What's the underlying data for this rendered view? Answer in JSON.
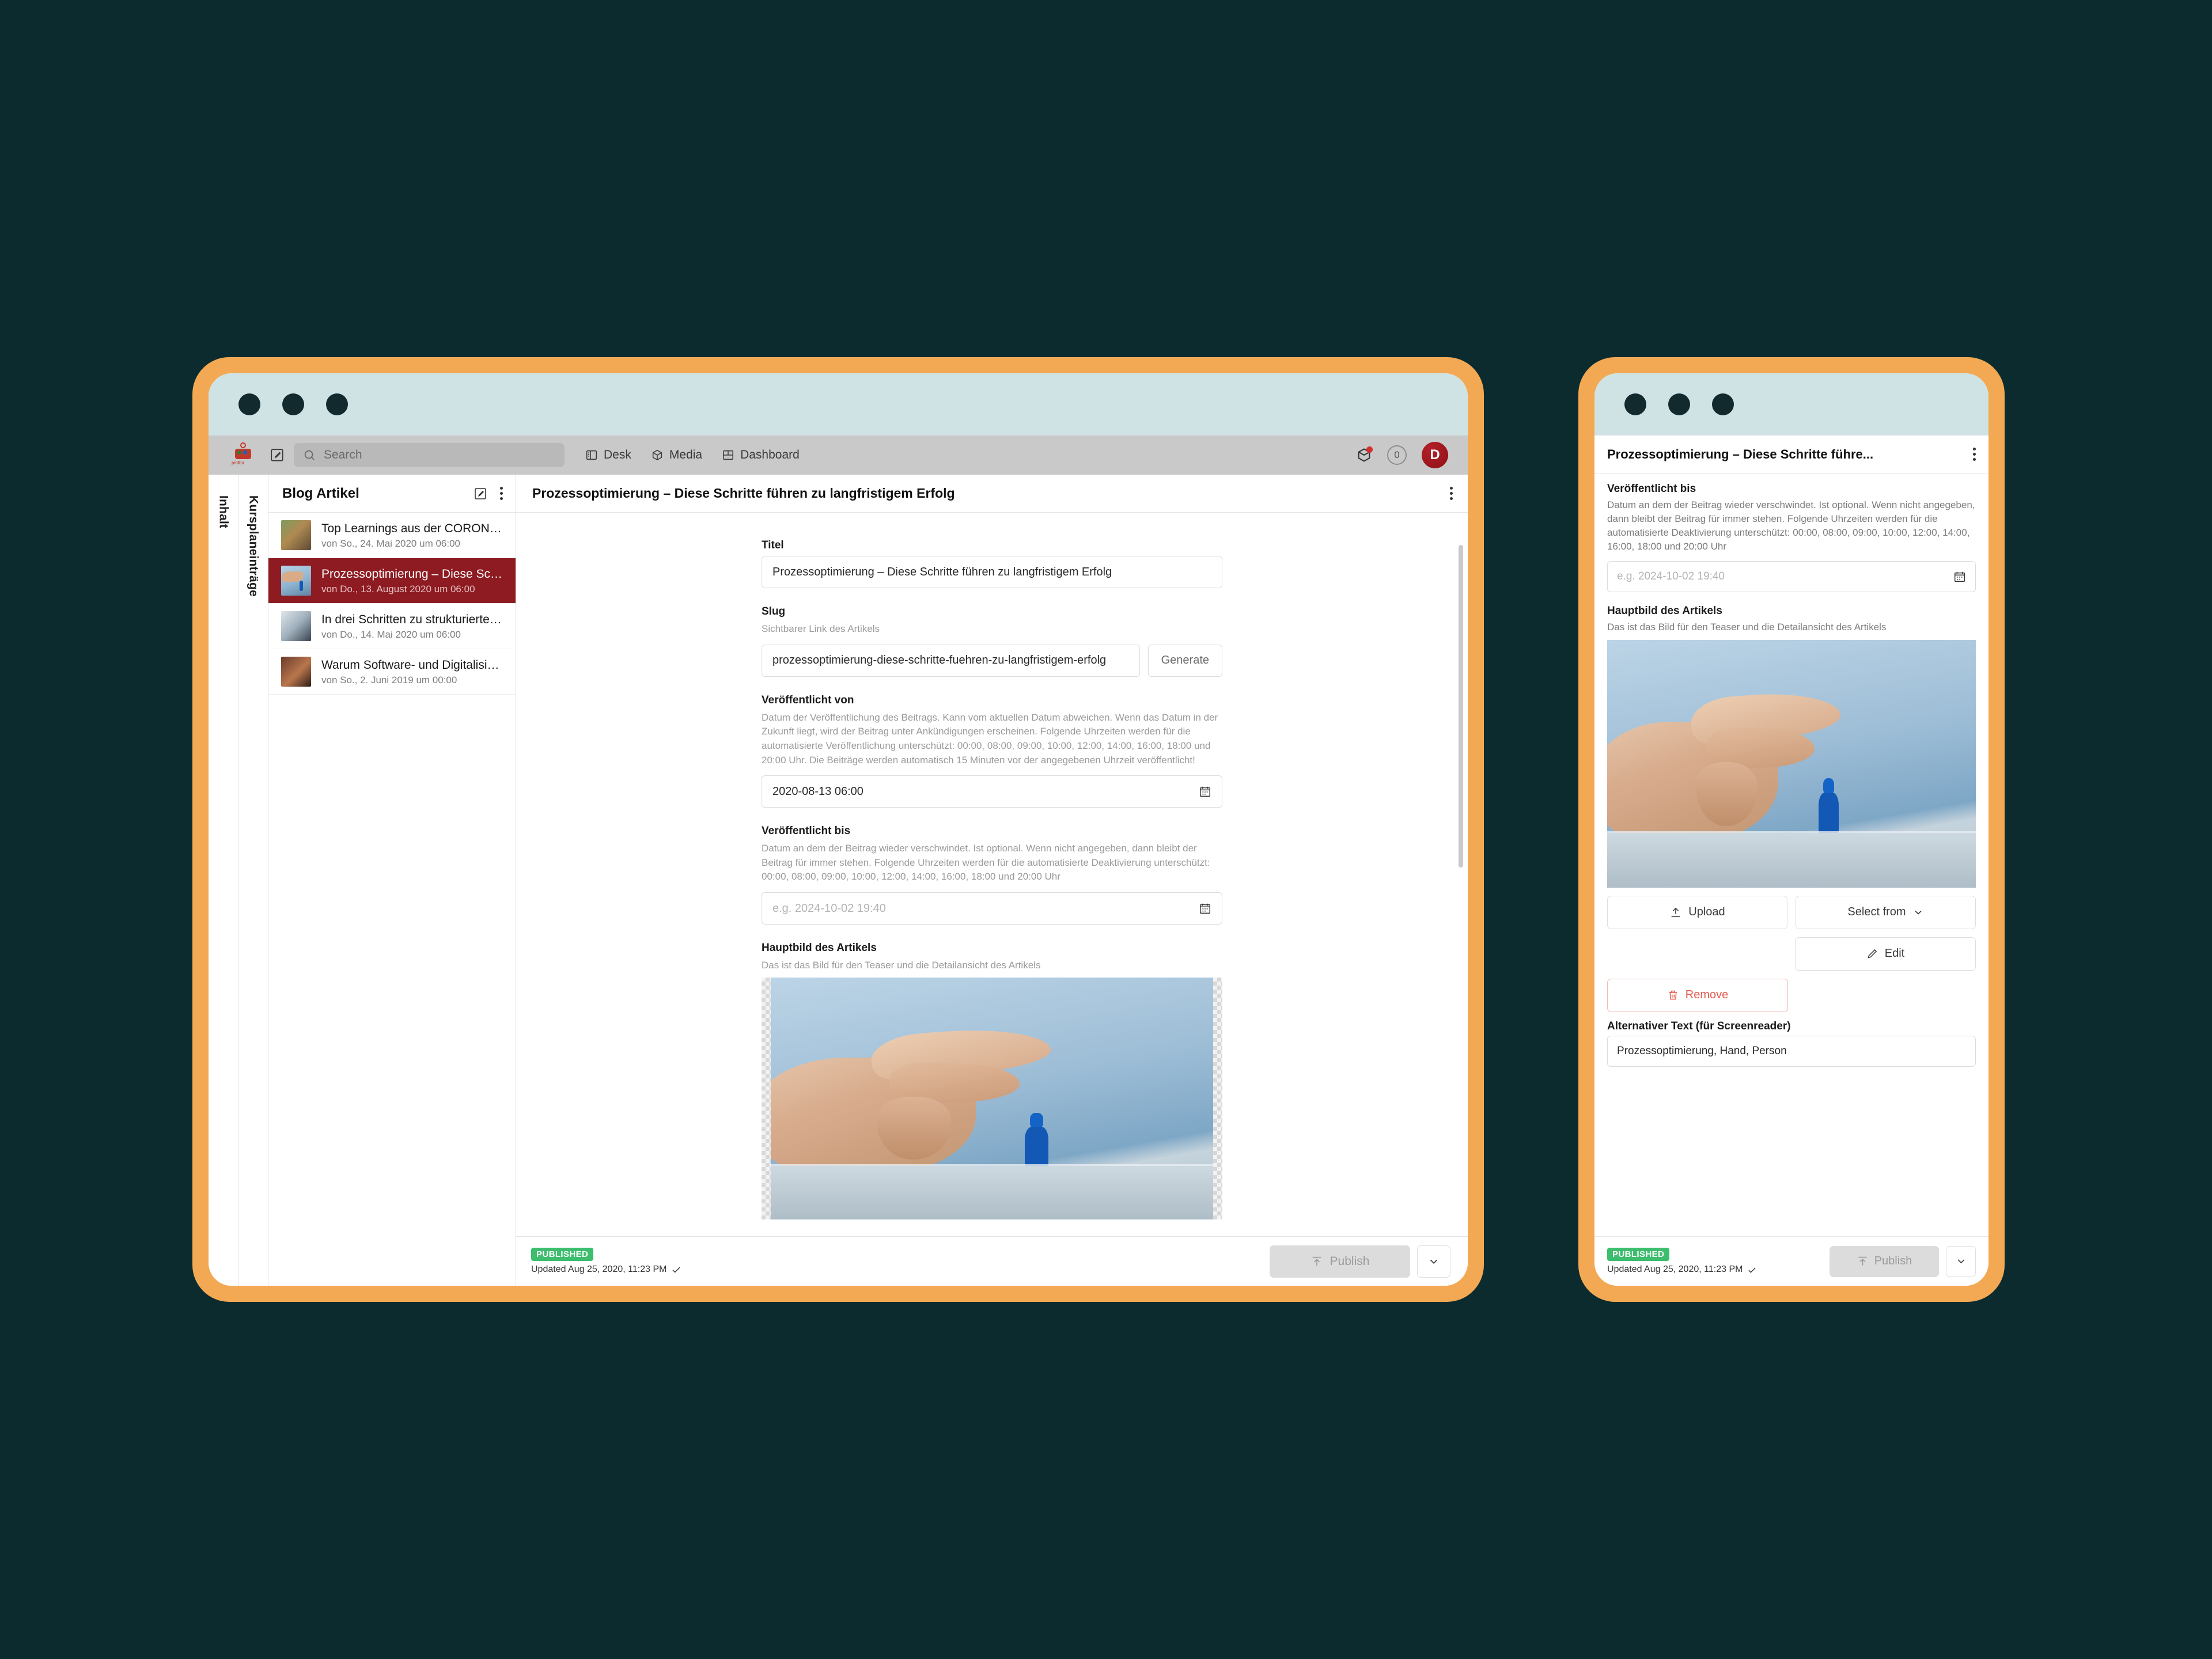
{
  "window": {
    "traffic_dots": [
      "close",
      "minimize",
      "maximize"
    ]
  },
  "topbar": {
    "logo_text": "profitur",
    "search_placeholder": "Search",
    "nav": [
      {
        "label": "Desk",
        "icon": "desk-icon"
      },
      {
        "label": "Media",
        "icon": "media-cube-icon"
      },
      {
        "label": "Dashboard",
        "icon": "dashboard-grid-icon"
      }
    ],
    "notification_count": "0",
    "avatar_initial": "D"
  },
  "vertical_tabs": [
    {
      "label": "Inhalt"
    },
    {
      "label": "Kursplaneinträge"
    }
  ],
  "list_pane": {
    "title": "Blog Artikel",
    "items": [
      {
        "title": "Top Learnings aus der CORONA K...",
        "meta": "von So., 24. Mai 2020 um 06:00",
        "selected": false
      },
      {
        "title": "Prozessoptimierung – Diese Schrit...",
        "meta": "von Do., 13. August 2020 um 06:00",
        "selected": true
      },
      {
        "title": "In drei Schritten zu strukturierten ...",
        "meta": "von Do., 14. Mai 2020 um 06:00",
        "selected": false
      },
      {
        "title": "Warum Software- und Digitalisieru...",
        "meta": "von So., 2. Juni 2019 um 00:00",
        "selected": false
      }
    ]
  },
  "editor": {
    "header_title": "Prozessoptimierung – Diese Schritte führen zu langfristigem Erfolg",
    "fields": {
      "titel": {
        "label": "Titel",
        "value": "Prozessoptimierung – Diese Schritte führen zu langfristigem Erfolg"
      },
      "slug": {
        "label": "Slug",
        "description": "Sichtbarer Link des Artikels",
        "value": "prozessoptimierung-diese-schritte-fuehren-zu-langfristigem-erfolg",
        "generate_label": "Generate"
      },
      "published_from": {
        "label": "Veröffentlicht von",
        "description": "Datum der Veröffentlichung des Beitrags. Kann vom aktuellen Datum abweichen. Wenn das Datum in der Zukunft liegt, wird der Beitrag unter Ankündigungen erscheinen. Folgende Uhrzeiten werden für die automatisierte Veröffentlichung unterschützt: 00:00, 08:00, 09:00, 10:00, 12:00, 14:00, 16:00, 18:00 und 20:00 Uhr. Die Beiträge werden automatisch 15 Minuten vor der angegebenen Uhrzeit veröffentlicht!",
        "value": "2020-08-13 06:00"
      },
      "published_to": {
        "label": "Veröffentlicht bis",
        "description": "Datum an dem der Beitrag wieder verschwindet. Ist optional. Wenn nicht angegeben, dann bleibt der Beitrag für immer stehen. Folgende Uhrzeiten werden für die automatisierte Deaktivierung unterschützt: 00:00, 08:00, 09:00, 10:00, 12:00, 14:00, 16:00, 18:00 und 20:00 Uhr",
        "placeholder": "e.g. 2024-10-02 19:40"
      },
      "main_image": {
        "label": "Hauptbild des Artikels",
        "description": "Das ist das Bild für den Teaser und die Detailansicht des Artikels"
      }
    },
    "footer": {
      "status_badge": "PUBLISHED",
      "updated_text": "Updated Aug 25, 2020, 11:23 PM",
      "publish_label": "Publish"
    }
  },
  "mobile": {
    "header_title": "Prozessoptimierung – Diese Schritte führe...",
    "published_to": {
      "label": "Veröffentlicht bis",
      "description": "Datum an dem der Beitrag wieder verschwindet. Ist optional. Wenn nicht angegeben, dann bleibt der Beitrag für immer stehen. Folgende Uhrzeiten werden für die automatisierte Deaktivierung unterschützt: 00:00, 08:00, 09:00, 10:00, 12:00, 14:00, 16:00, 18:00 und 20:00 Uhr",
      "placeholder": "e.g. 2024-10-02 19:40"
    },
    "main_image": {
      "label": "Hauptbild des Artikels",
      "description": "Das ist das Bild für den Teaser und die Detailansicht des Artikels"
    },
    "buttons": {
      "upload": "Upload",
      "select_from": "Select from",
      "edit": "Edit",
      "remove": "Remove"
    },
    "alt_text": {
      "label": "Alternativer Text (für Screenreader)",
      "value": "Prozessoptimierung, Hand, Person"
    },
    "footer": {
      "status_badge": "PUBLISHED",
      "updated_text": "Updated Aug 25, 2020, 11:23 PM",
      "publish_label": "Publish"
    }
  },
  "colors": {
    "frame": "#f3a953",
    "titlebar": "#cfe3e5",
    "page_background": "#0b2b2e",
    "selected_row": "#8e1b22",
    "published_green": "#3dbd6e",
    "danger_red": "#e2574c",
    "avatar_red": "#a3161f"
  }
}
